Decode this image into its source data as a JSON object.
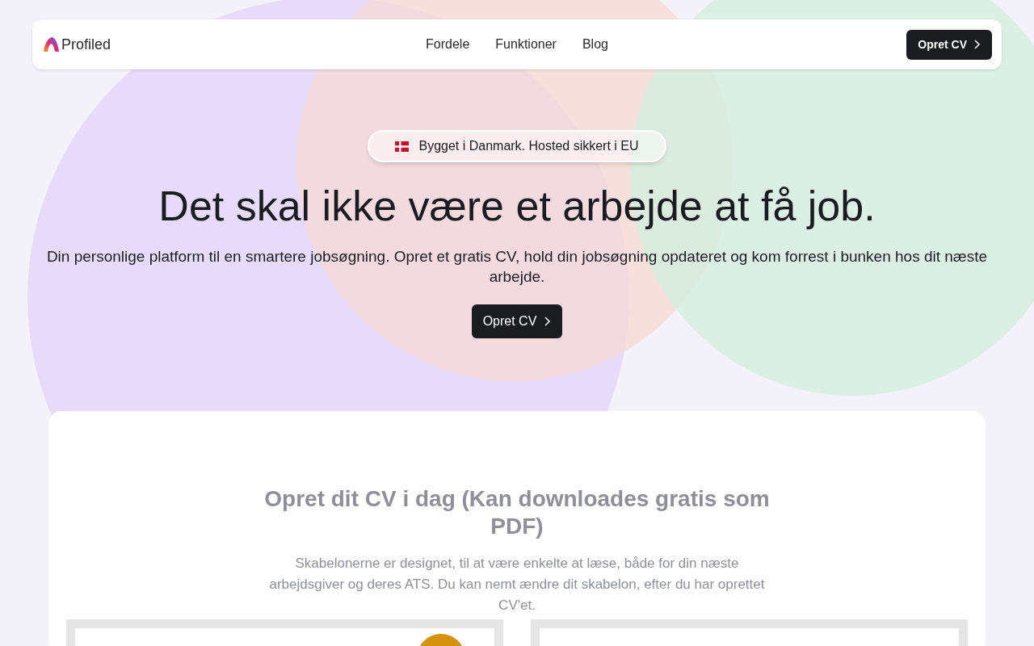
{
  "nav": {
    "brand": "Profiled",
    "links": [
      "Fordele",
      "Funktioner",
      "Blog"
    ],
    "cta": "Opret CV"
  },
  "hero": {
    "badge": "Bygget i Danmark. Hosted sikkert i EU",
    "title": "Det skal ikke være et arbejde at få job.",
    "subtitle": "Din personlige platform til en smartere jobsøgning. Opret et gratis CV, hold din jobsøgning opdateret og kom forrest i bunken hos dit næste arbejde.",
    "cta": "Opret CV"
  },
  "section": {
    "title": "Opret dit CV i dag (Kan downloades gratis som PDF)",
    "text": "Skabelonerne er designet, til at være enkelte at læse, både for din næste arbejdsgiver og deres ATS. Du kan nemt ændre dit skabelon, efter du har oprettet CV'et.",
    "templates": [
      {
        "kind": "photo"
      },
      {
        "kind": "plain"
      }
    ]
  }
}
